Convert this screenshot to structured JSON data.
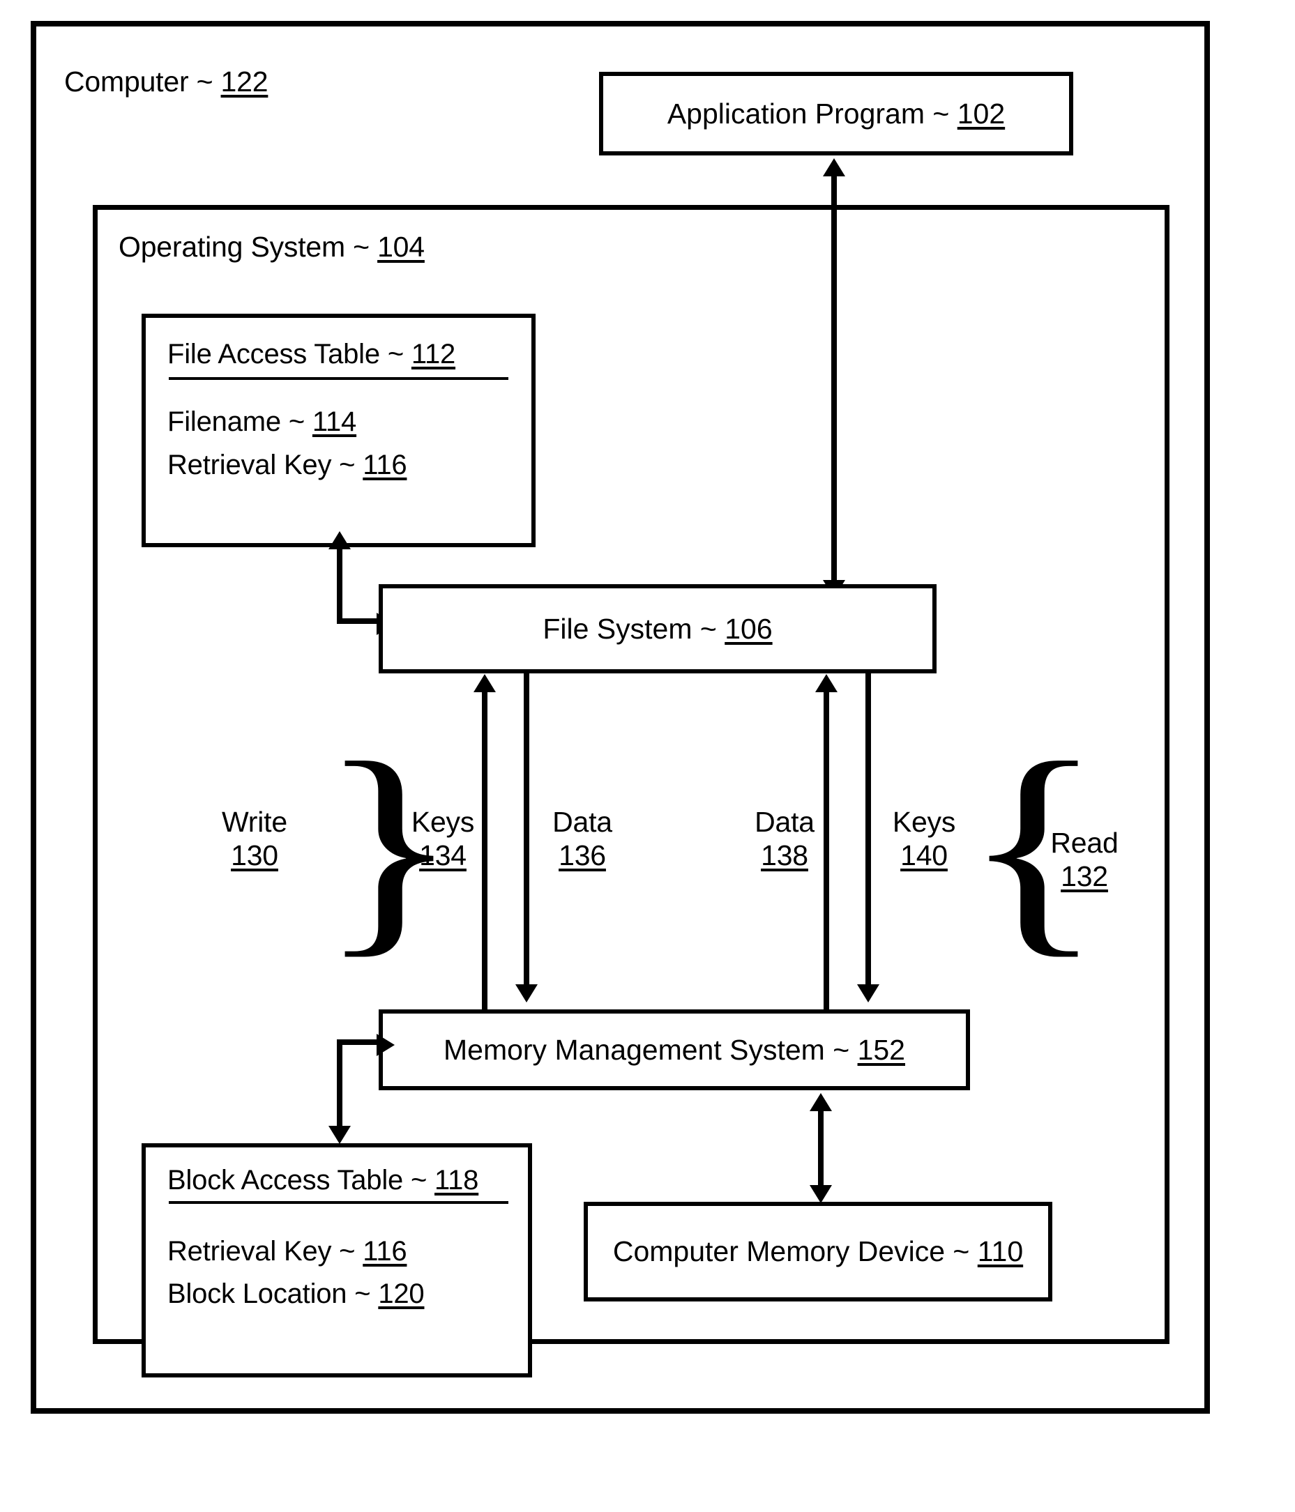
{
  "figure": {
    "type": "patent-block-diagram",
    "outer_frame": {
      "label": "Computer ~ ",
      "ref": "122"
    },
    "inner_frame": {
      "label": "Operating System ~ ",
      "ref": "104"
    }
  },
  "boxes": {
    "application_program": {
      "label": "Application Program ~ ",
      "ref": "102"
    },
    "file_access_table": {
      "title": "File Access Table ~ ",
      "title_ref": "112",
      "rows": [
        {
          "label": "Filename ~ ",
          "ref": "114"
        },
        {
          "label": "Retrieval Key ~ ",
          "ref": "116"
        }
      ]
    },
    "file_system": {
      "label": "File System ~ ",
      "ref": "106"
    },
    "memory_management_system": {
      "label": "Memory Management System ~ ",
      "ref": "152"
    },
    "block_access_table": {
      "title": "Block Access Table ~ ",
      "title_ref": "118",
      "rows": [
        {
          "label": "Retrieval Key ~ ",
          "ref": "116"
        },
        {
          "label": "Block Location ~ ",
          "ref": "120"
        }
      ]
    },
    "computer_memory_device": {
      "label": "Computer Memory Device ~ ",
      "ref": "110"
    }
  },
  "flow_labels": {
    "write": {
      "name": "Write",
      "ref": "130"
    },
    "keys_write": {
      "name": "Keys",
      "ref": "134"
    },
    "data_write": {
      "name": "Data",
      "ref": "136"
    },
    "data_read": {
      "name": "Data",
      "ref": "138"
    },
    "keys_read": {
      "name": "Keys",
      "ref": "140"
    },
    "read": {
      "name": "Read",
      "ref": "132"
    }
  },
  "braces": {
    "write_brace": "}",
    "read_brace": "{"
  },
  "colors": {
    "ink": "#000000",
    "paper": "#ffffff"
  }
}
